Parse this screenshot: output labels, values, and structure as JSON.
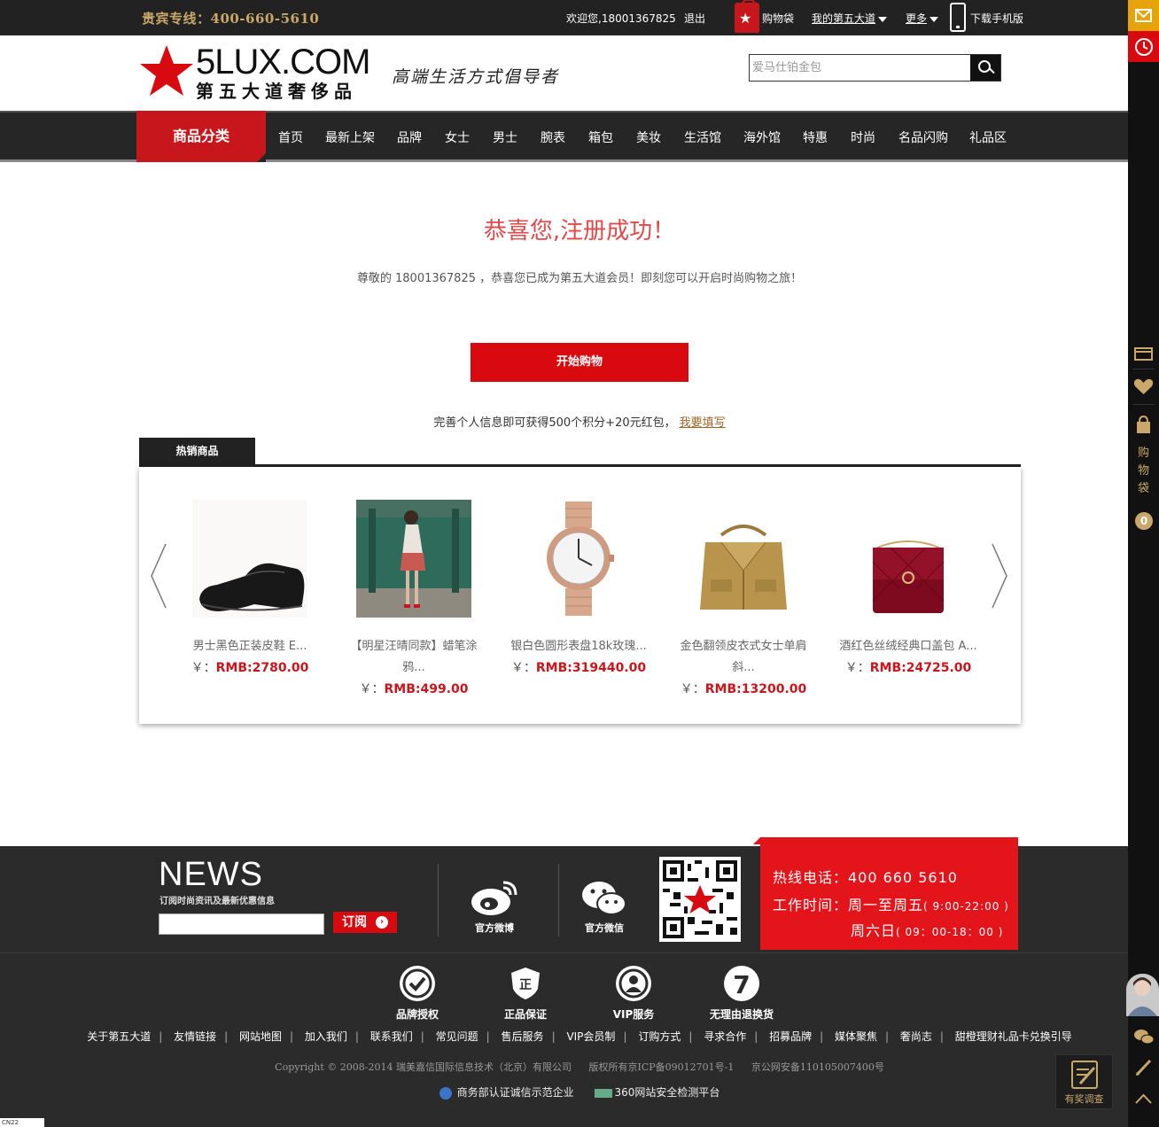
{
  "topbar": {
    "hotline": "贵宾专线：400-660-5610",
    "welcome": "欢迎您,18001367825",
    "logout": "退出",
    "cart": "购物袋",
    "my_account": "我的第五大道",
    "more": "更多",
    "mobile": "下载手机版"
  },
  "header": {
    "logo_text": "5LUX.COM",
    "logo_sub": "第五大道奢侈品",
    "slogan": "高端生活方式倡导者",
    "search_placeholder": "爱马仕铂金包"
  },
  "nav": {
    "category": "商品分类",
    "items": [
      "首页",
      "最新上架",
      "品牌",
      "女士",
      "男士",
      "腕表",
      "箱包",
      "美妆",
      "生活馆",
      "海外馆",
      "特惠",
      "时尚",
      "名品闪购",
      "礼品区"
    ]
  },
  "main": {
    "title": "恭喜您,注册成功！",
    "message": "尊敬的 18001367825 ，恭喜您已成为第五大道会员！即刻您可以开启时尚购物之旅！",
    "start_button": "开始购物",
    "complete_text": "完善个人信息即可获得500个积分+20元红包，",
    "complete_link": "我要填写",
    "hot_tab": "热销商品",
    "products": [
      {
        "name": "男士黑色正装皮鞋 E...",
        "name2": "",
        "yen": "￥：",
        "price": "RMB:2780.00"
      },
      {
        "name": "【明星汪晴同款】蜡笔涂",
        "name2": "鸦...",
        "yen": "￥：",
        "price": "RMB:499.00"
      },
      {
        "name": "银白色圆形表盘18k玫瑰...",
        "name2": "",
        "yen": "￥：",
        "price": "RMB:319440.00"
      },
      {
        "name": "金色翻领皮衣式女士单肩",
        "name2": "斜...",
        "yen": "￥：",
        "price": "RMB:13200.00"
      },
      {
        "name": "酒红色丝绒经典口盖包 A...",
        "name2": "",
        "yen": "￥：",
        "price": "RMB:24725.00"
      }
    ]
  },
  "footer": {
    "news_title": "NEWS",
    "news_sub": "订阅时尚资讯及最新优惠信息",
    "subscribe": "订阅",
    "weibo": "官方微博",
    "wechat": "官方微信",
    "hotline": "热线电话：400 660 5610",
    "hours_weekday": "工作时间：周一至周五",
    "hours_weekday_time": "( 9:00-22:00 )",
    "hours_sunday": "周六日",
    "hours_sunday_time": "( 09：00-18：00 )",
    "badges": [
      "品牌授权",
      "正品保证",
      "VIP服务",
      "无理由退换货"
    ],
    "links": [
      "关于第五大道",
      "友情链接",
      "网站地图",
      "加入我们",
      "联系我们",
      "常见问题",
      "售后服务",
      "VIP会员制",
      "订购方式",
      "寻求合作",
      "招募品牌",
      "媒体聚焦",
      "奢尚志",
      "甜橙理财礼品卡兑换引导"
    ],
    "copyright": "Copyright © 2008-2014 瑞美嘉信国际信息技术（北京）有限公司",
    "icp": "版权所有京ICP备09012701号-1",
    "police": "京公网安备110105007400号",
    "cert1": "商务部认证诚信示范企业",
    "cert2": "360网站安全检测平台",
    "survey": "有奖调查",
    "corner": "CN22"
  },
  "sidebar": {
    "cart_text": [
      "购",
      "物",
      "袋"
    ],
    "cart_count": "0"
  },
  "colors": {
    "brand_red": "#d8090f",
    "gold": "#c9a86a",
    "dark": "#222222"
  }
}
